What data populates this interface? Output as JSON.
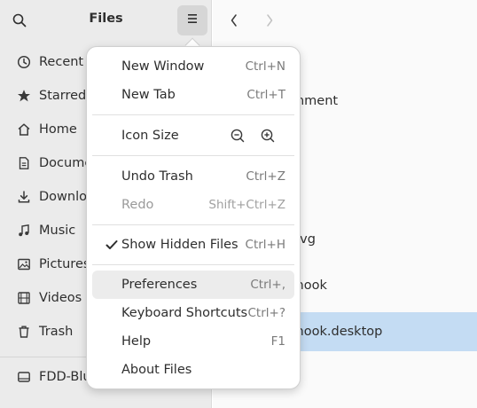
{
  "sidebar": {
    "title": "Files",
    "items": [
      {
        "label": "Recent",
        "icon": "clock-icon"
      },
      {
        "label": "Starred",
        "icon": "star-icon"
      },
      {
        "label": "Home",
        "icon": "home-icon"
      },
      {
        "label": "Docume",
        "icon": "document-icon"
      },
      {
        "label": "Downloa",
        "icon": "download-icon"
      },
      {
        "label": "Music",
        "icon": "music-icon"
      },
      {
        "label": "Pictures",
        "icon": "picture-icon"
      },
      {
        "label": "Videos",
        "icon": "video-icon"
      },
      {
        "label": "Trash",
        "icon": "trash-icon"
      }
    ],
    "devices": [
      {
        "label": "FDD-Blu",
        "icon": "drive-icon"
      }
    ]
  },
  "main": {
    "files": [
      {
        "name": "chment",
        "selected": false
      },
      {
        "name": ".svg",
        "selected": false
      },
      {
        "name": "snook",
        "selected": false
      },
      {
        "name": "snook.desktop",
        "selected": true
      }
    ]
  },
  "menu": {
    "new_window": {
      "label": "New Window",
      "shortcut": "Ctrl+N"
    },
    "new_tab": {
      "label": "New Tab",
      "shortcut": "Ctrl+T"
    },
    "icon_size": {
      "label": "Icon Size"
    },
    "undo_trash": {
      "label": "Undo Trash",
      "shortcut": "Ctrl+Z"
    },
    "redo": {
      "label": "Redo",
      "shortcut": "Shift+Ctrl+Z",
      "disabled": true
    },
    "show_hidden": {
      "label": "Show Hidden Files",
      "shortcut": "Ctrl+H",
      "checked": true
    },
    "preferences": {
      "label": "Preferences",
      "shortcut": "Ctrl+,"
    },
    "keyboard_shortcuts": {
      "label": "Keyboard Shortcuts",
      "shortcut": "Ctrl+?"
    },
    "help": {
      "label": "Help",
      "shortcut": "F1"
    },
    "about": {
      "label": "About Files"
    }
  },
  "colors": {
    "sidebar_bg": "#ebebeb",
    "selection": "#c4dcf3",
    "menu_hover": "#ececec"
  }
}
